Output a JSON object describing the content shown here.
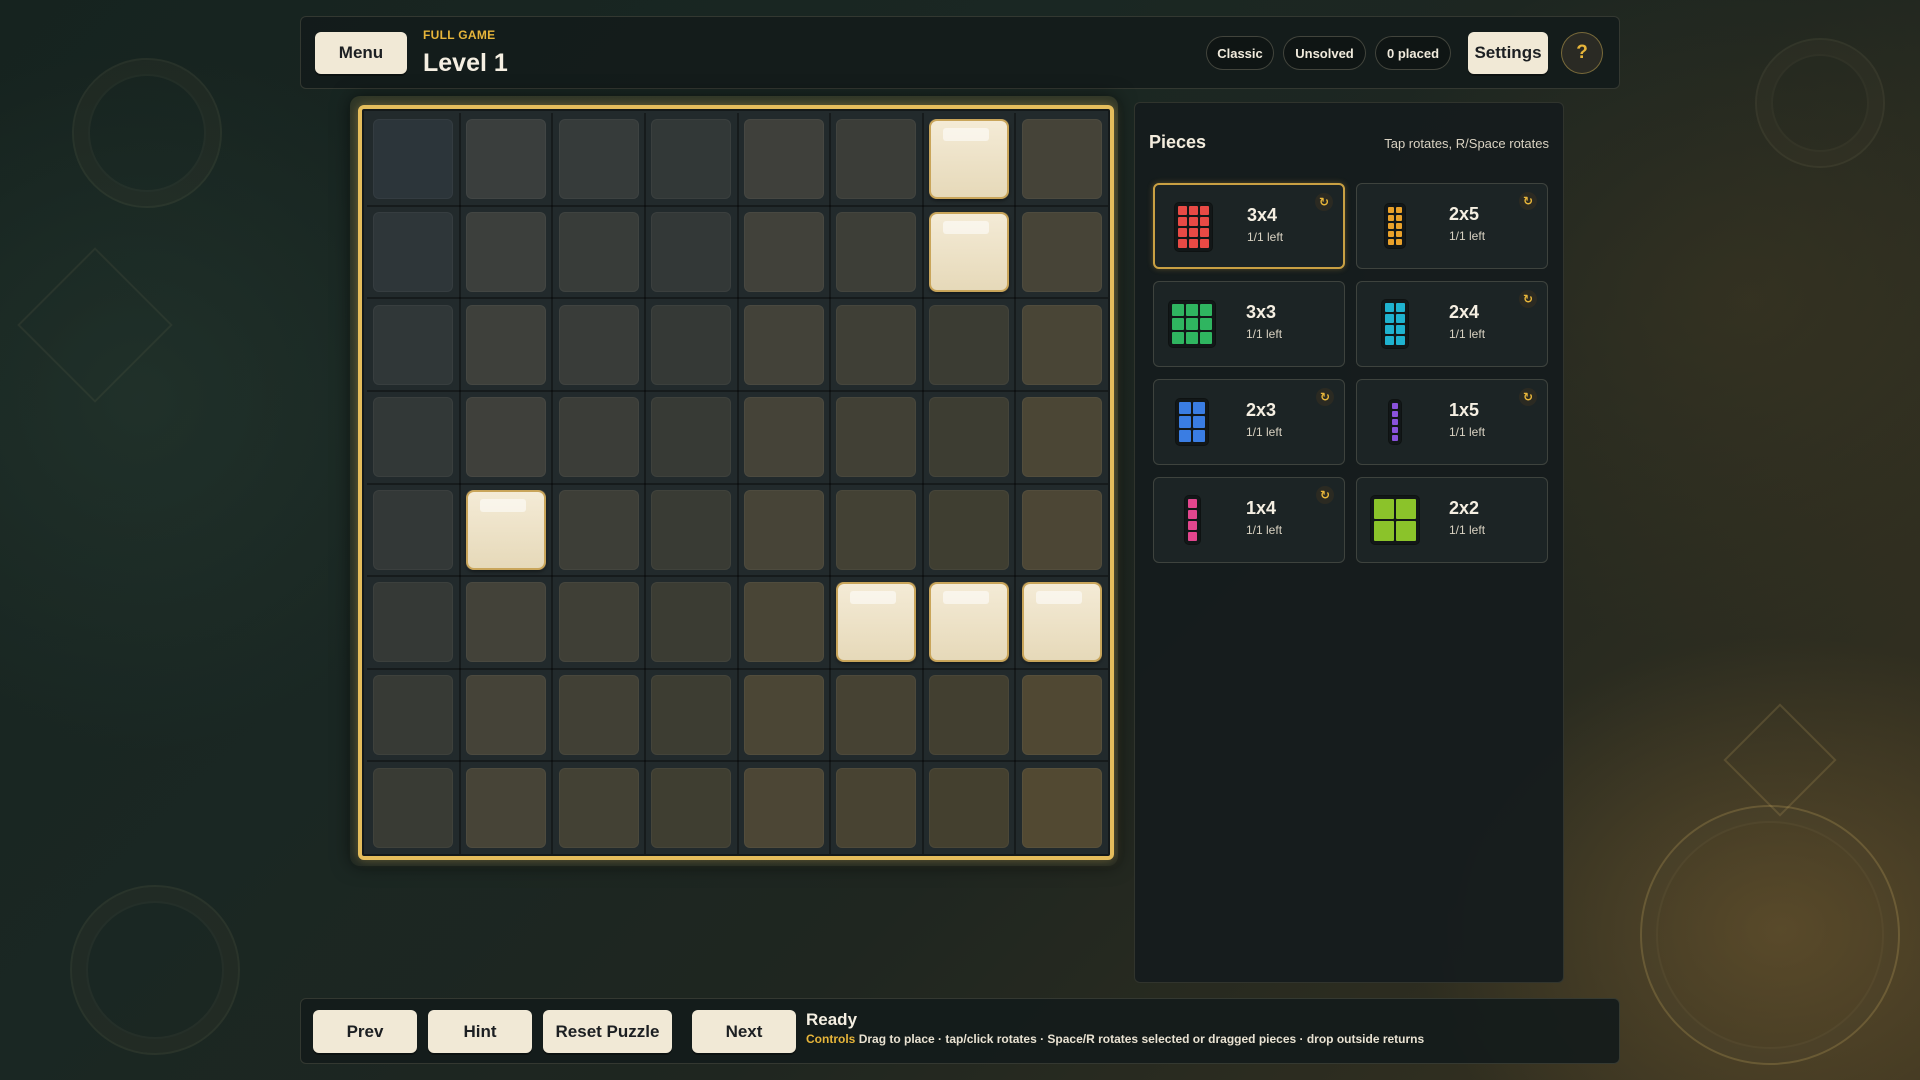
{
  "header": {
    "menu_label": "Menu",
    "subtitle": "FULL GAME",
    "title": "Level 1",
    "mode_pill": "Classic",
    "status_pill": "Unsolved",
    "placed_pill": "0 placed",
    "settings_label": "Settings",
    "help_label": "?"
  },
  "board": {
    "rows": 8,
    "cols": 8,
    "blocked_cells": [
      [
        0,
        6
      ],
      [
        1,
        6
      ],
      [
        4,
        1
      ],
      [
        5,
        5
      ],
      [
        5,
        6
      ],
      [
        5,
        7
      ]
    ]
  },
  "pieces_panel": {
    "title": "Pieces",
    "hint": "Tap rotates, R/Space rotates",
    "pieces": [
      {
        "name": "3x4",
        "count": "1/1 left",
        "color": "#e84a45",
        "w": 3,
        "h": 4,
        "rotatable": true,
        "selected": true
      },
      {
        "name": "2x5",
        "count": "1/1 left",
        "color": "#e9a12a",
        "w": 2,
        "h": 5,
        "rotatable": true,
        "selected": false
      },
      {
        "name": "3x3",
        "count": "1/1 left",
        "color": "#2fb560",
        "w": 3,
        "h": 3,
        "rotatable": false,
        "selected": false
      },
      {
        "name": "2x4",
        "count": "1/1 left",
        "color": "#1fb2cf",
        "w": 2,
        "h": 4,
        "rotatable": true,
        "selected": false
      },
      {
        "name": "2x3",
        "count": "1/1 left",
        "color": "#3a7de3",
        "w": 2,
        "h": 3,
        "rotatable": true,
        "selected": false
      },
      {
        "name": "1x5",
        "count": "1/1 left",
        "color": "#8a52dc",
        "w": 1,
        "h": 5,
        "rotatable": true,
        "selected": false
      },
      {
        "name": "1x4",
        "count": "1/1 left",
        "color": "#e3468e",
        "w": 1,
        "h": 4,
        "rotatable": true,
        "selected": false
      },
      {
        "name": "2x2",
        "count": "1/1 left",
        "color": "#8bc32a",
        "w": 2,
        "h": 2,
        "rotatable": false,
        "selected": false
      }
    ],
    "rotate_icon": "rotate-icon",
    "rotate_glyph": "↻"
  },
  "footer": {
    "prev_label": "Prev",
    "hint_label": "Hint",
    "reset_label": "Reset Puzzle",
    "next_label": "Next",
    "status": "Ready",
    "controls_label": "Controls",
    "controls_text": "Drag to place · tap/click rotates · Space/R rotates selected or dragged pieces · drop outside returns"
  }
}
